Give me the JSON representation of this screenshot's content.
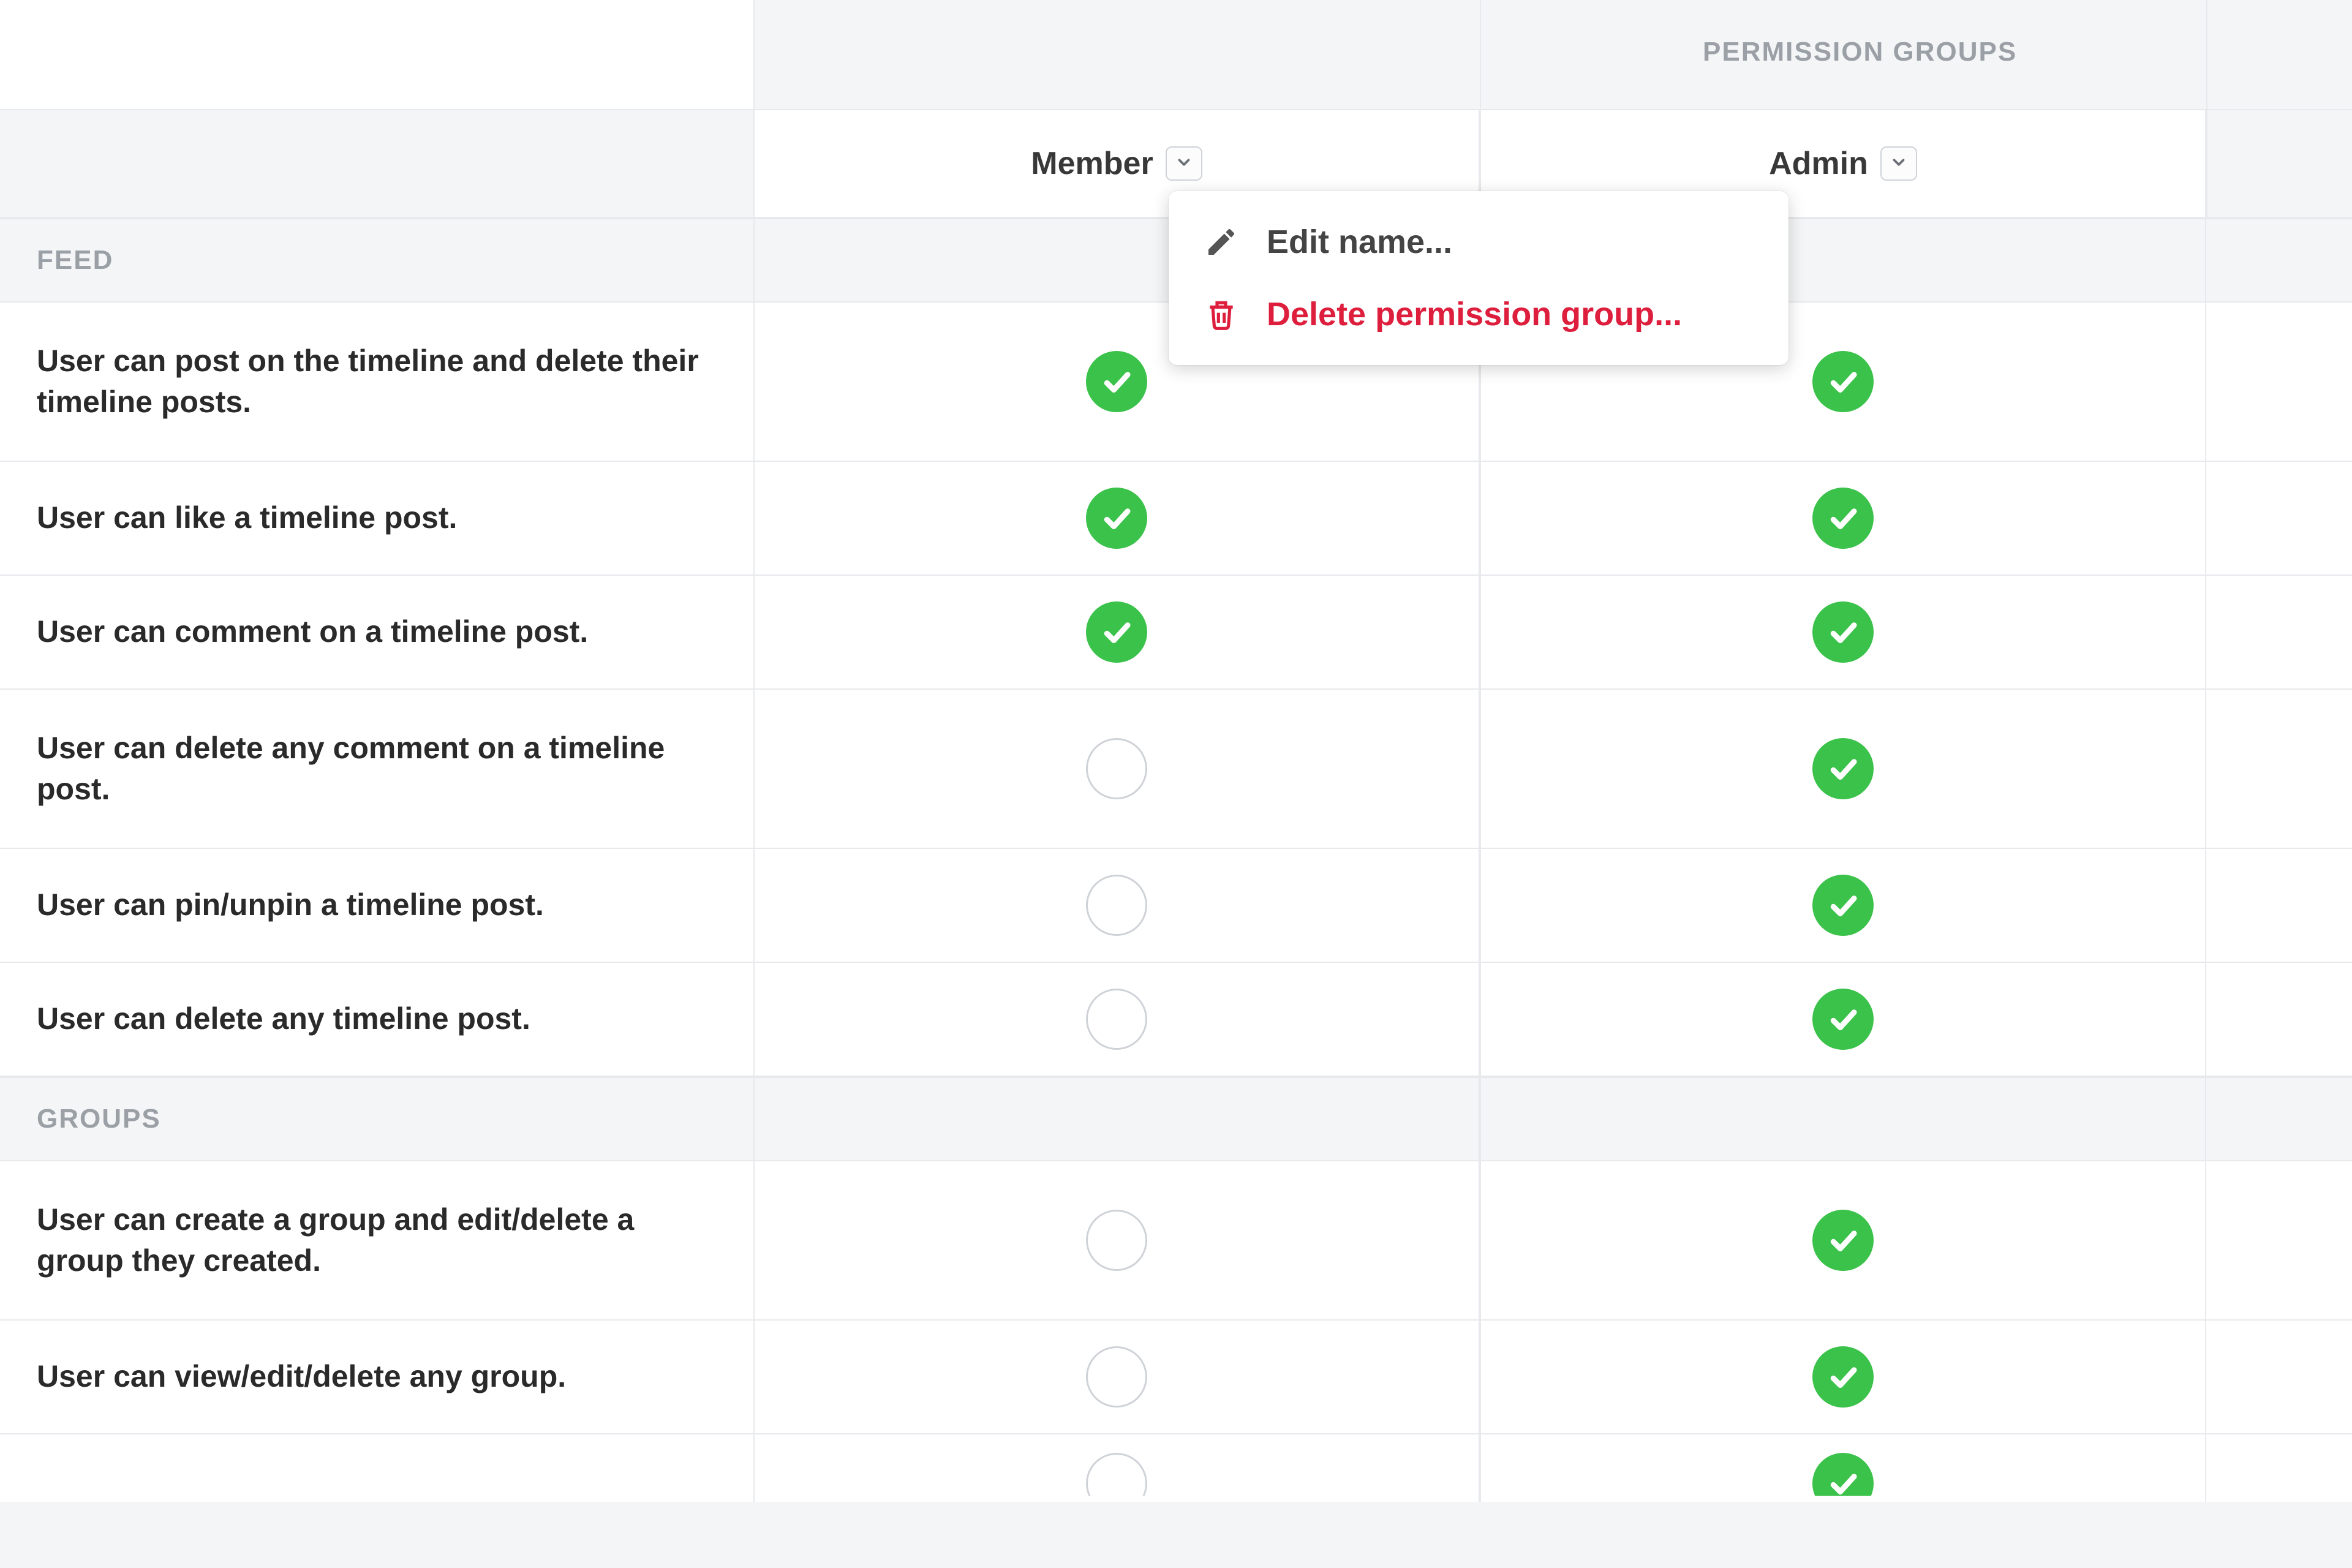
{
  "header": {
    "permission_groups_label": "PERMISSION GROUPS",
    "columns": [
      {
        "id": "member",
        "label": "Member"
      },
      {
        "id": "admin",
        "label": "Admin"
      }
    ]
  },
  "dropdown": {
    "edit_label": "Edit name...",
    "delete_label": "Delete permission group..."
  },
  "sections": [
    {
      "id": "feed",
      "title": "FEED",
      "permissions": [
        {
          "label": "User can post on the timeline and delete their timeline posts.",
          "member": true,
          "admin": true,
          "tall": true
        },
        {
          "label": "User can like a timeline post.",
          "member": true,
          "admin": true,
          "tall": false
        },
        {
          "label": "User can comment on a timeline post.",
          "member": true,
          "admin": true,
          "tall": false
        },
        {
          "label": "User can delete any comment on a timeline post.",
          "member": false,
          "admin": true,
          "tall": true
        },
        {
          "label": "User can pin/unpin a timeline post.",
          "member": false,
          "admin": true,
          "tall": false
        },
        {
          "label": "User can delete any timeline post.",
          "member": false,
          "admin": true,
          "tall": false
        }
      ]
    },
    {
      "id": "groups",
      "title": "GROUPS",
      "permissions": [
        {
          "label": "User can create a group and edit/delete a group they created.",
          "member": false,
          "admin": true,
          "tall": true
        },
        {
          "label": "User can view/edit/delete any group.",
          "member": false,
          "admin": true,
          "tall": false
        },
        {
          "label": "",
          "member": false,
          "admin": true,
          "tall": false,
          "partial": true
        }
      ]
    }
  ],
  "colors": {
    "check_green": "#3bc24a",
    "danger_red": "#dd1f3d",
    "muted_text": "#9aa0a6"
  }
}
